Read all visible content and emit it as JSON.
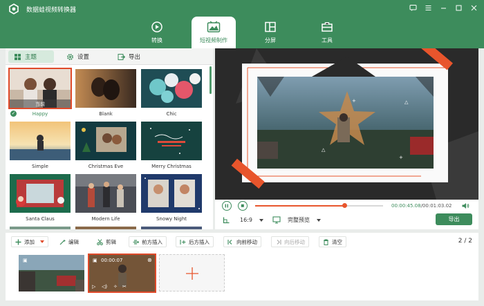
{
  "app": {
    "title": "数据蛙视频转换器"
  },
  "nav": {
    "tabs": [
      {
        "label": "转换"
      },
      {
        "label": "短视频制作"
      },
      {
        "label": "分屏"
      },
      {
        "label": "工具"
      }
    ]
  },
  "subtabs": {
    "theme": "主题",
    "settings": "设置",
    "export": "导出"
  },
  "themes": [
    {
      "name": "Happy",
      "selected": true,
      "tag": "当前"
    },
    {
      "name": "Blank"
    },
    {
      "name": "Chic"
    },
    {
      "name": "Simple"
    },
    {
      "name": "Christmas Eve"
    },
    {
      "name": "Merry Christmas"
    },
    {
      "name": "Santa Claus"
    },
    {
      "name": "Modern Life"
    },
    {
      "name": "Snowy Night"
    }
  ],
  "player": {
    "current_time": "00:00:45.08",
    "total_time": "/00:01:03.02",
    "progress": 0.7,
    "aspect": "16:9",
    "preview_mode": "完整预览",
    "export_label": "导出"
  },
  "toolbar": {
    "add": "添加",
    "edit": "编辑",
    "cut": "剪辑",
    "insert_before": "前方插入",
    "insert_after": "后方插入",
    "move_forward": "向前移动",
    "move_back": "向后移动",
    "clear": "清空",
    "page": "2 / 2"
  },
  "clips": [
    {
      "duration": ""
    },
    {
      "duration": "00:00:07",
      "selected": true
    }
  ],
  "colors": {
    "brand": "#3d8c5c",
    "accent": "#e8552c"
  }
}
